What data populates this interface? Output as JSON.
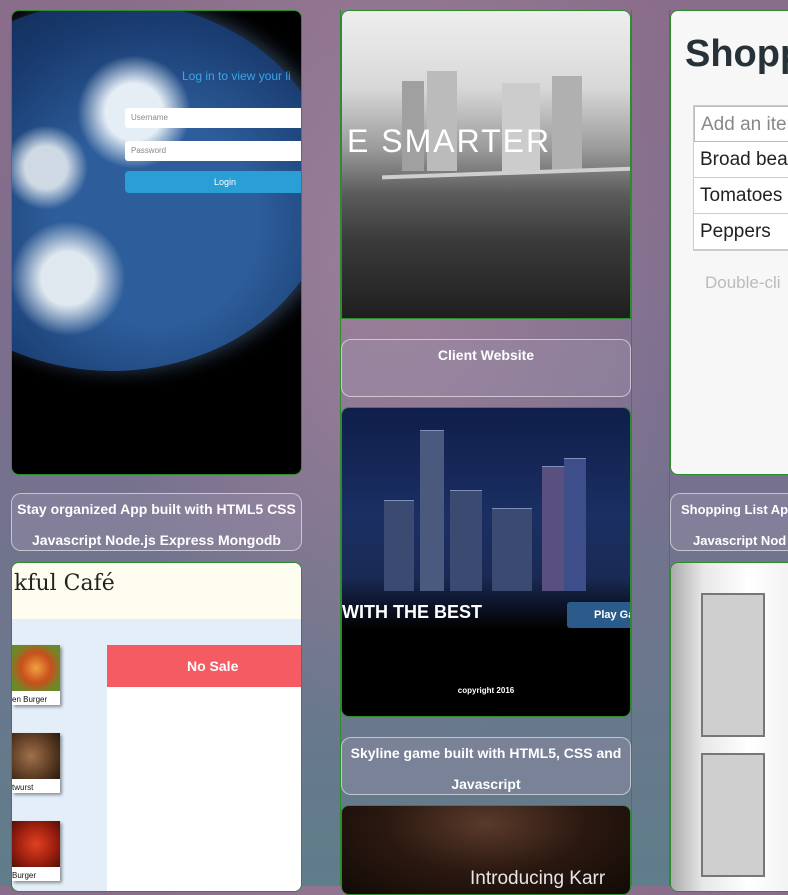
{
  "projects": {
    "stay_organized": {
      "login_title": "Log in to view your li",
      "username_placeholder": "Username",
      "password_placeholder": "Password",
      "login_button": "Login",
      "caption_line1": "Stay organized App built with HTML5 CSS",
      "caption_line2": "Javascript Node.js Express Mongodb"
    },
    "client_website": {
      "hero_text": "E SMARTER",
      "caption": "Client Website"
    },
    "skyline_game": {
      "tagline": "WITH THE BEST",
      "play_button": "Play Ga",
      "copyright": "copyright 2016",
      "caption_line1": "Skyline game built with HTML5, CSS and",
      "caption_line2": "Javascript"
    },
    "karaoke": {
      "hero_text": "Introducing Karr"
    },
    "shopping_list": {
      "title": "Shopp",
      "add_placeholder": "Add an iter",
      "items": [
        "Broad bea",
        "Tomatoes",
        "Peppers"
      ],
      "hint": "Double-cli",
      "caption_line1": "Shopping List Ap",
      "caption_line2": "Javascript Nod"
    },
    "cafe": {
      "title": "kful Café",
      "menu_items": [
        "en Burger",
        "twurst",
        "Burger"
      ],
      "no_sale": "No Sale"
    }
  },
  "colors": {
    "border_green": "#2e8b2e",
    "no_sale_red": "#f45b63",
    "login_blue": "#2a9fd6"
  }
}
